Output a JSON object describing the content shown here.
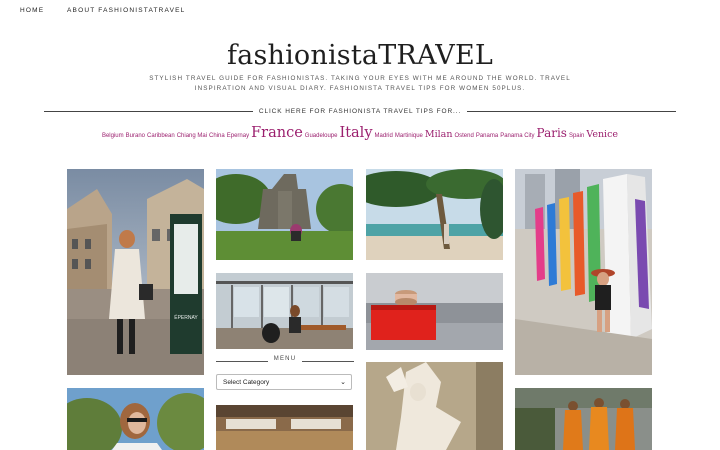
{
  "nav": {
    "home": "HOME",
    "about": "ABOUT FASHIONISTATRAVEL"
  },
  "header": {
    "title": "fashionistaTRAVEL",
    "tagline": "STYLISH TRAVEL GUIDE FOR FASHIONISTAS. TAKING YOUR EYES WITH ME AROUND THE WORLD. TRAVEL INSPIRATION AND VISUAL DIARY. FASHIONISTA TRAVEL TIPS FOR WOMEN 50PLUS.",
    "tips_link": "CLICK HERE FOR FASHIONISTA TRAVEL TIPS FOR..."
  },
  "tags": [
    {
      "label": "Belgium",
      "size": "small"
    },
    {
      "label": "Burano",
      "size": "small"
    },
    {
      "label": "Caribbean",
      "size": "small"
    },
    {
      "label": "Chiang Mai",
      "size": "small"
    },
    {
      "label": "China",
      "size": "small"
    },
    {
      "label": "Epernay",
      "size": "small"
    },
    {
      "label": "France",
      "size": "xlarge"
    },
    {
      "label": "Guadeloupe",
      "size": "small"
    },
    {
      "label": "Italy",
      "size": "xlarge"
    },
    {
      "label": "Madrid",
      "size": "small"
    },
    {
      "label": "Martinique",
      "size": "small"
    },
    {
      "label": "Milan",
      "size": "medium"
    },
    {
      "label": "Ostend",
      "size": "small"
    },
    {
      "label": "Panama",
      "size": "small"
    },
    {
      "label": "Panama City",
      "size": "small"
    },
    {
      "label": "Paris",
      "size": "large"
    },
    {
      "label": "Spain",
      "size": "small"
    },
    {
      "label": "Venice",
      "size": "medium"
    }
  ],
  "sidebar": {
    "menu_title": "MENU",
    "select_value": "Select Category"
  },
  "tiles": {
    "t1_sign": "ÉPERNAY"
  }
}
